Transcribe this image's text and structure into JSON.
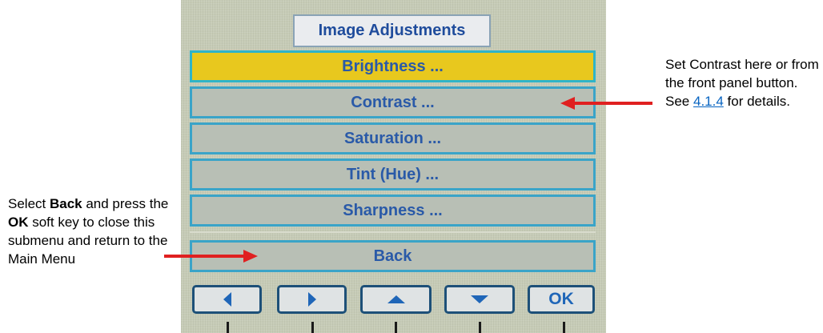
{
  "menu": {
    "title": "Image Adjustments",
    "items": [
      {
        "label": "Brightness ...",
        "selected": true
      },
      {
        "label": "Contrast ...",
        "selected": false
      },
      {
        "label": "Saturation ...",
        "selected": false
      },
      {
        "label": "Tint (Hue) ...",
        "selected": false
      },
      {
        "label": "Sharpness ...",
        "selected": false
      }
    ],
    "back_label": "Back"
  },
  "softkeys": [
    {
      "icon": "left-arrow-icon"
    },
    {
      "icon": "right-arrow-icon"
    },
    {
      "icon": "up-arrow-icon"
    },
    {
      "icon": "down-arrow-icon"
    },
    {
      "label": "OK"
    }
  ],
  "annotations": {
    "right": {
      "text": "Set Contrast here or from the front panel button. See ",
      "link": "4.1.4",
      "suffix": " for details."
    },
    "left": {
      "part1": "Select ",
      "bold1": "Back",
      "part2": " and press the ",
      "bold2": "OK",
      "part3": " soft key to close this submenu and return to the Main Menu"
    }
  },
  "colors": {
    "selected_bg": "#e8c81e",
    "item_border": "#3aa4c8",
    "item_text": "#2a5aa8",
    "arrow": "#e02020",
    "link": "#0563c1"
  }
}
